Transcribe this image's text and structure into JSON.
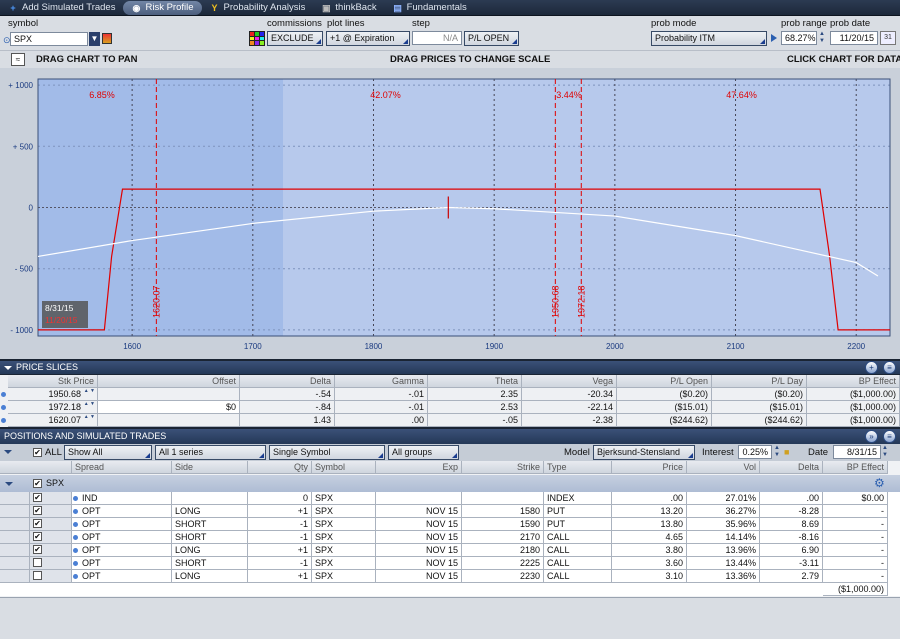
{
  "tabs": [
    {
      "label": "Add Simulated Trades",
      "icon": "plus-icon",
      "active": false
    },
    {
      "label": "Risk Profile",
      "icon": "eye-icon",
      "active": true
    },
    {
      "label": "Probability Analysis",
      "icon": "y-icon",
      "active": false
    },
    {
      "label": "thinkBack",
      "icon": "camera-icon",
      "active": false
    },
    {
      "label": "Fundamentals",
      "icon": "building-icon",
      "active": false
    }
  ],
  "controls": {
    "symbol_label": "symbol",
    "symbol_value": "SPX",
    "commissions_label": "commissions",
    "commissions_value": "EXCLUDE",
    "plot_lines_label": "plot lines",
    "plot_lines_value": "+1 @ Expiration",
    "step_label": "step",
    "step_value": "N/A",
    "pl_mode": "P/L OPEN",
    "prob_mode_label": "prob mode",
    "prob_mode_value": "Probability ITM",
    "prob_range_label": "prob range",
    "prob_range_value": "68.27%",
    "prob_date_label": "prob date",
    "prob_date_value": "11/20/15",
    "drag_pan": "DRAG CHART TO PAN",
    "drag_prices": "DRAG PRICES TO CHANGE SCALE",
    "click_chart": "CLICK CHART FOR DATA"
  },
  "chart_data": {
    "type": "line",
    "x_ticks": [
      1600,
      1700,
      1800,
      1900,
      2000,
      2100,
      2200
    ],
    "y_ticks": [
      {
        "v": 1000,
        "label": "+ 1000"
      },
      {
        "v": 500,
        "label": "+ 500"
      },
      {
        "v": 0,
        "label": "0"
      },
      {
        "v": -500,
        "label": "- 500"
      },
      {
        "v": -1000,
        "label": "- 1000"
      }
    ],
    "xlim": [
      1522,
      2228
    ],
    "ylim": [
      -1050,
      1050
    ],
    "series": [
      {
        "label": "expiration",
        "color": "#e00000",
        "x": [
          1522,
          1577,
          1583,
          1592,
          2170,
          2178,
          2185,
          2228
        ],
        "y": [
          -1000,
          -1000,
          -400,
          150,
          150,
          -400,
          -1000,
          -1000
        ]
      },
      {
        "label": "today",
        "color": "#ffffff",
        "x": [
          1522,
          1600,
          1700,
          1800,
          1862,
          1900,
          2000,
          2100,
          2200,
          2218
        ],
        "y": [
          -400,
          -270,
          -130,
          -30,
          0,
          -10,
          -70,
          -230,
          -450,
          -560
        ]
      }
    ],
    "price_slices": [
      {
        "x": 1620.07,
        "label": "1620.07"
      },
      {
        "x": 1950.68,
        "label": "1950.68"
      },
      {
        "x": 1972.18,
        "label": "1972.18"
      }
    ],
    "probabilities": [
      {
        "x": 1575,
        "label": "6.85%"
      },
      {
        "x": 1810,
        "label": "42.07%"
      },
      {
        "x": 1962,
        "label": "3.44%"
      },
      {
        "x": 2105,
        "label": "47.64%"
      }
    ],
    "tag_date": "8/31/15",
    "tag_date2": "11/20/15",
    "highlight_range": [
      1522,
      1725
    ]
  },
  "price_slices": {
    "title": "PRICE SLICES",
    "headers": [
      "Stk Price",
      "Offset",
      "Delta",
      "Gamma",
      "Theta",
      "Vega",
      "P/L Open",
      "P/L Day",
      "BP Effect"
    ],
    "rows": [
      [
        "1950.68",
        "",
        "-.54",
        "-.01",
        "2.35",
        "-20.34",
        "($0.20)",
        "($0.20)",
        "($1,000.00)"
      ],
      [
        "1972.18",
        "$0",
        "-.84",
        "-.01",
        "2.53",
        "-22.14",
        "($15.01)",
        "($15.01)",
        "($1,000.00)"
      ],
      [
        "1620.07",
        "",
        "1.43",
        ".00",
        "-.05",
        "-2.38",
        "($244.62)",
        "($244.62)",
        "($1,000.00)"
      ]
    ]
  },
  "positions": {
    "title": "POSITIONS AND SIMULATED TRADES",
    "all_label": "ALL",
    "show_filter": "Show All",
    "series_filter": "All 1 series",
    "symbol_filter": "Single Symbol",
    "group_filter": "All groups",
    "model_label": "Model",
    "model_value": "Bjerksund-Stensland",
    "interest_label": "Interest",
    "interest_value": "0.25%",
    "date_label": "Date",
    "date_value": "8/31/15",
    "headers": [
      "Spread",
      "Side",
      "Qty",
      "Symbol",
      "Exp",
      "Strike",
      "Type",
      "Price",
      "Vol",
      "Delta",
      "BP Effect"
    ],
    "group": "SPX",
    "rows": [
      [
        "IND",
        "",
        "0",
        "SPX",
        "",
        "",
        "INDEX",
        ".00",
        "27.01%",
        ".00",
        "$0.00"
      ],
      [
        "OPT",
        "LONG",
        "+1",
        "SPX",
        "NOV 15",
        "1580",
        "PUT",
        "13.20",
        "36.27%",
        "-8.28",
        "-"
      ],
      [
        "OPT",
        "SHORT",
        "-1",
        "SPX",
        "NOV 15",
        "1590",
        "PUT",
        "13.80",
        "35.96%",
        "8.69",
        "-"
      ],
      [
        "OPT",
        "SHORT",
        "-1",
        "SPX",
        "NOV 15",
        "2170",
        "CALL",
        "4.65",
        "14.14%",
        "-8.16",
        "-"
      ],
      [
        "OPT",
        "LONG",
        "+1",
        "SPX",
        "NOV 15",
        "2180",
        "CALL",
        "3.80",
        "13.96%",
        "6.90",
        "-"
      ],
      [
        "OPT",
        "SHORT",
        "-1",
        "SPX",
        "NOV 15",
        "2225",
        "CALL",
        "3.60",
        "13.44%",
        "-3.11",
        "-"
      ],
      [
        "OPT",
        "LONG",
        "+1",
        "SPX",
        "NOV 15",
        "2230",
        "CALL",
        "3.10",
        "13.36%",
        "2.79",
        "-"
      ]
    ],
    "checked": [
      true,
      true,
      true,
      true,
      true,
      false,
      false
    ],
    "total": "($1,000.00)"
  }
}
